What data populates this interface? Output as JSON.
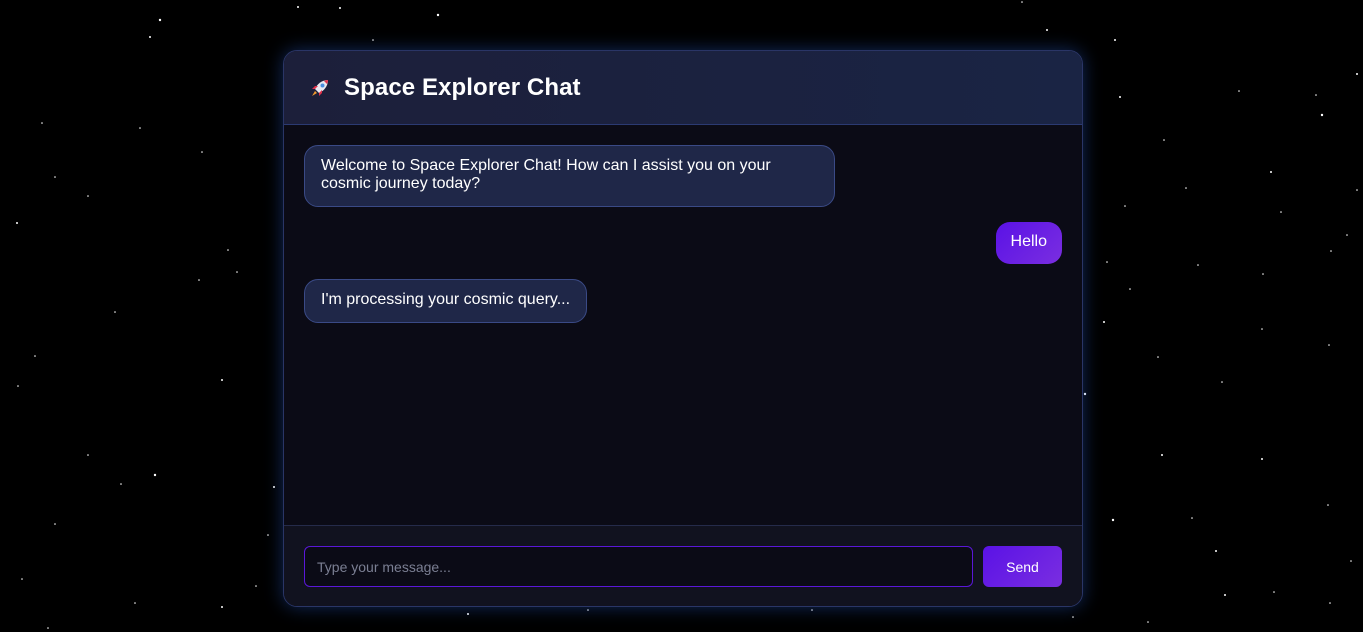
{
  "header": {
    "icon": "rocket-icon",
    "title": "Space Explorer Chat"
  },
  "messages": [
    {
      "sender": "bot",
      "text": "Welcome to Space Explorer Chat! How can I assist you on your cosmic journey today?"
    },
    {
      "sender": "user",
      "text": "Hello"
    },
    {
      "sender": "bot",
      "text": "I'm processing your cosmic query..."
    }
  ],
  "composer": {
    "placeholder": "Type your message...",
    "value": "",
    "send_label": "Send"
  },
  "colors": {
    "background": "#000000",
    "panel": "#0b0b16",
    "header": "#1c1f3a",
    "bot_bubble": "#1f2748",
    "accent": "#6a1ee6"
  }
}
